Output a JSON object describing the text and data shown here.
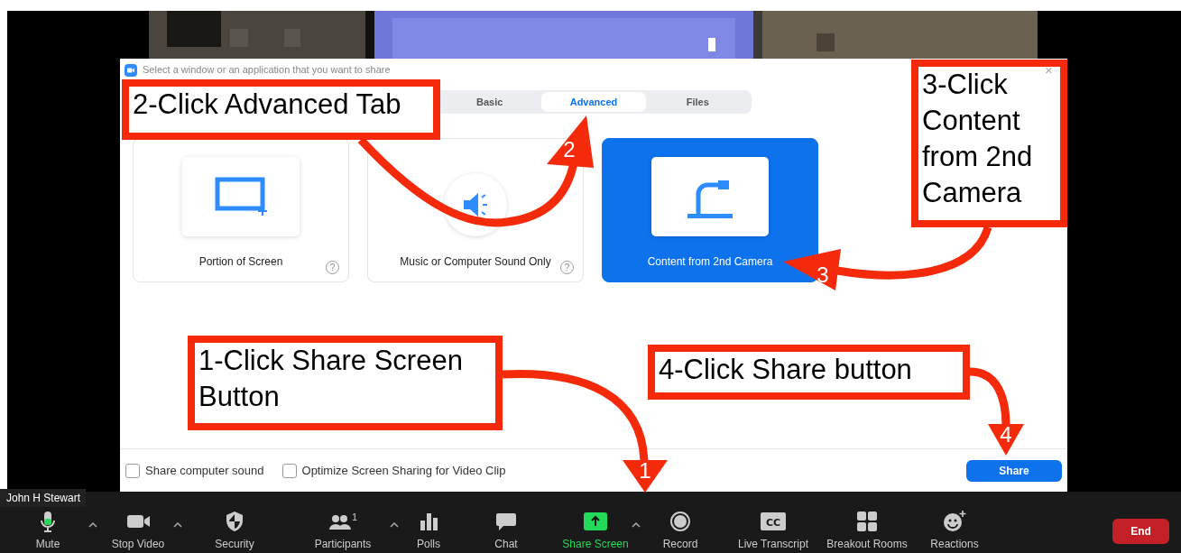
{
  "video_label": "John H Stewart",
  "dialog": {
    "title": "Select a window or an application that you want to share",
    "tabs": [
      {
        "label": "Basic",
        "selected": false
      },
      {
        "label": "Advanced",
        "selected": true
      },
      {
        "label": "Files",
        "selected": false
      }
    ],
    "options": [
      {
        "label": "Portion of Screen",
        "kind": "portion",
        "selected": false,
        "help": "?"
      },
      {
        "label": "Music or Computer Sound Only",
        "kind": "sound",
        "selected": false,
        "help": "?"
      },
      {
        "label": "Content from 2nd Camera",
        "kind": "camera",
        "selected": true
      }
    ],
    "checkboxes": [
      {
        "label": "Share computer sound",
        "checked": false
      },
      {
        "label": "Optimize Screen Sharing for Video Clip",
        "checked": false
      }
    ],
    "share_button": "Share",
    "close": "×"
  },
  "toolbar": {
    "items": [
      {
        "label": "Mute",
        "kind": "mic",
        "has_menu": true,
        "active": false
      },
      {
        "label": "Stop Video",
        "kind": "video",
        "has_menu": true,
        "active": false
      },
      {
        "label": "Security",
        "kind": "shield",
        "has_menu": false,
        "active": false
      },
      {
        "label": "Participants",
        "kind": "people",
        "count": "1",
        "has_menu": true,
        "active": false
      },
      {
        "label": "Polls",
        "kind": "bars",
        "has_menu": false,
        "active": false
      },
      {
        "label": "Chat",
        "kind": "chat",
        "has_menu": false,
        "active": false
      },
      {
        "label": "Share Screen",
        "kind": "share",
        "has_menu": true,
        "active": true
      },
      {
        "label": "Record",
        "kind": "record",
        "has_menu": false,
        "active": false
      },
      {
        "label": "Live Transcript",
        "kind": "cc",
        "icon_text": "CC",
        "has_menu": false,
        "active": false
      },
      {
        "label": "Breakout Rooms",
        "kind": "grid",
        "has_menu": false,
        "active": false
      },
      {
        "label": "Reactions",
        "kind": "smile",
        "has_menu": false,
        "active": false
      }
    ],
    "end_button": "End"
  },
  "annotations": [
    {
      "text": "3-Click Content from 2nd Camera",
      "step": "3"
    },
    {
      "text": "2-Click Advanced Tab",
      "step": "2"
    },
    {
      "text": "1-Click Share Screen Button",
      "step": "1"
    },
    {
      "text": "4-Click Share button",
      "step": "4"
    }
  ]
}
